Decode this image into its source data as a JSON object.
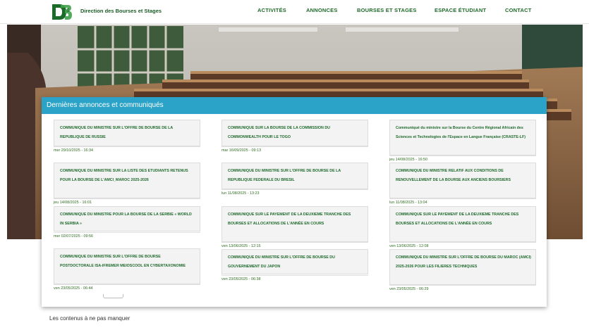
{
  "header": {
    "brand": "Direction des Bourses et Stages",
    "nav": [
      "ACTIVITÉS",
      "ANNONCES",
      "BOURSES ET STAGES",
      "ESPACE ÉTUDIANT",
      "CONTACT"
    ],
    "colors": {
      "nav": "#1f6b2a",
      "accent": "#2ba3c8"
    }
  },
  "panel": {
    "title": "Dernières annonces et communiqués",
    "cards": [
      {
        "title": "COMMUNIQUE DU MINISTRE SUR L'OFFRE DE BOURSE DE LA REPUBLIQUE DE RUSSIE",
        "date": "mer 29/10/2025 - 16:34"
      },
      {
        "title": "COMMUNIQUE SUR LA BOURSE DE LA COMMISSION DU COMMONWEALTH POUR LE TOGO",
        "date": "mar 16/09/2025 - 09:13"
      },
      {
        "title": "Communiqué du ministre sur la Bourse du Centre Régional Africain des Sciences et Technologies de l'Espace en Langue Française (CRASTE-LF)",
        "date": "jeu 14/08/2025 - 16:50"
      },
      {
        "title": "COMMUNIQUE DU MINISTRE SUR LA LISTE DES ETUDIANTS RETENUS POUR LA BOURSE DE L'AMCI_MAROC 2025-2026",
        "date": "jeu 14/08/2025 - 16:01"
      },
      {
        "title": "COMMUNIQUE DU MINISTRE SUR L'OFFRE DE BOURSE DE LA REPUBLIQUE FEDERALE DU BRESIL",
        "date": "lun 11/08/2025 - 13:23"
      },
      {
        "title": "COMMUNIQUE DU MINISTRE RELATIF AUX CONDITIONS DE RENOUVELLEMENT DE LA BOURSE AUX ANCIENS BOURSIERS",
        "date": "lun 11/08/2025 - 13:04"
      },
      {
        "title": "COMMUNIQUE DU MINISTRE POUR LA BOURSE DE LA SERBIE « WORLD IN SERBIA »",
        "date": "mer 02/07/2025 - 09:56"
      },
      {
        "title": "COMMUNIQUE SUR LE PAYEMENT DE LA DEUXIEME TRANCHE DES BOURSES ET ALLOCATIONS DE L'ANNÉE EN COURS",
        "date": "ven 13/06/2025 - 12:15"
      },
      {
        "title": "COMMUNIQUE SUR LE PAYEMENT DE LA DEUXIEME TRANCHE DES BOURSES ET ALLOCATIONS DE L'ANNÉE EN COURS",
        "date": "ven 13/06/2025 - 12:08"
      },
      {
        "title": "COMMUNIQUE DU MINISTRE SUR L'OFFRE DE BOURSE POSTDOCTORALE ISA-IFREMER MEIOSCOOL EN CYBERTAXONOMIE",
        "date": "ven 23/05/2025 - 06:44"
      },
      {
        "title": "COMMUNIQUE DU MINISTRE SUR L'OFFRE DE BOURSE DU GOUVERNEMENT DU JAPON",
        "date": "ven 23/05/2025 - 06:38"
      },
      {
        "title": "COMMUNIQUE DU MINISTRE SUR L'OFFRE DE BOURSE DU MAROC (AMCI) 2025-2026 POUR LES FILIERES TECHNIQUES",
        "date": "ven 23/05/2025 - 06:29"
      }
    ]
  },
  "footer": {
    "heading": "Les contenus à ne pas manquer"
  }
}
